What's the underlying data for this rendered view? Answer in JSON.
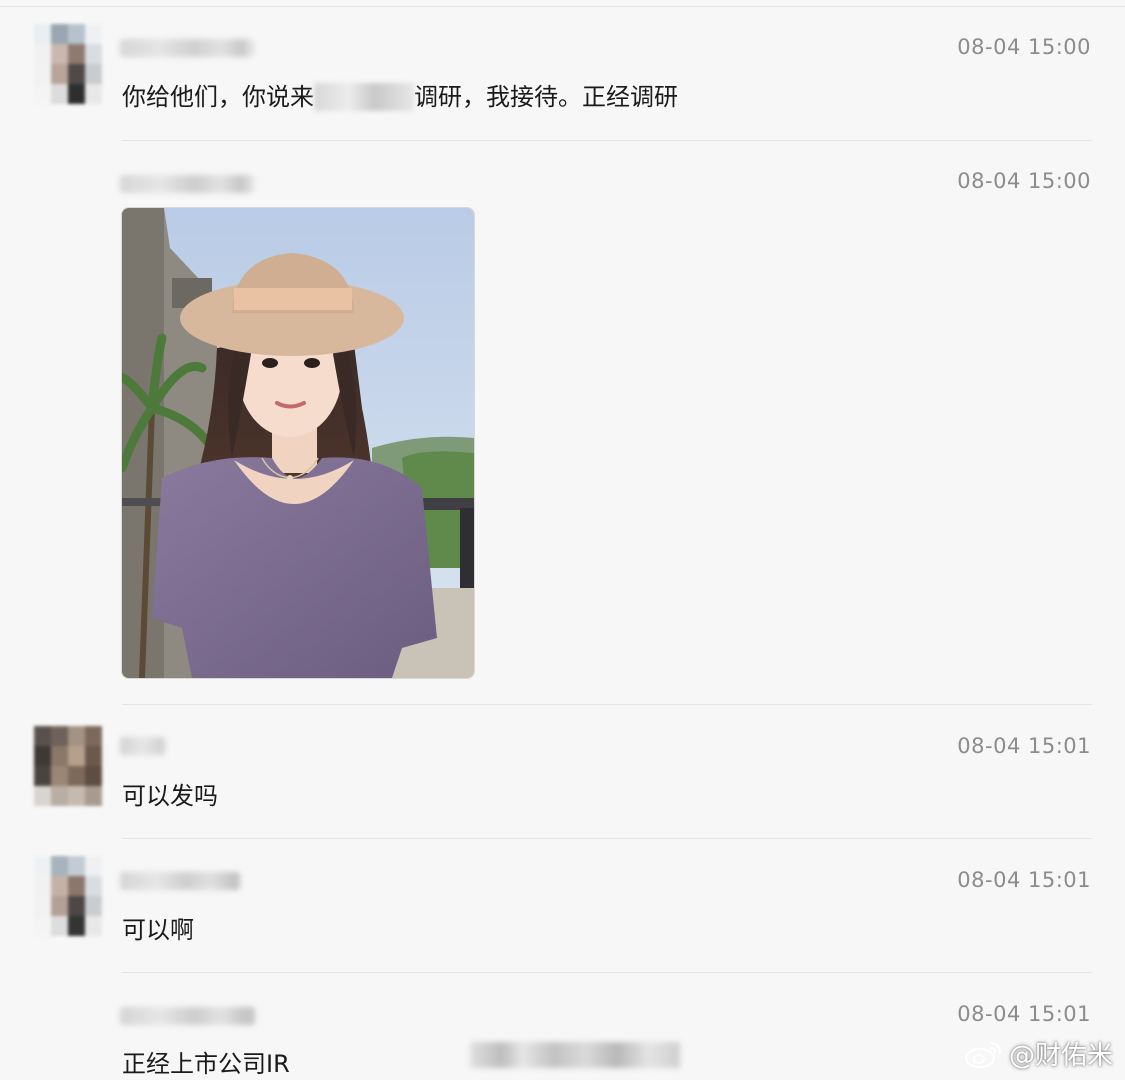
{
  "messages": [
    {
      "timestamp": "08-04 15:00",
      "text_before": "你给他们，你说来",
      "text_after": "调研，我接待。正经调研"
    },
    {
      "timestamp": "08-04 15:00",
      "image_alt": "照片"
    },
    {
      "timestamp": "08-04 15:01",
      "text": "可以发吗"
    },
    {
      "timestamp": "08-04 15:01",
      "text": "可以啊"
    },
    {
      "timestamp": "08-04 15:01",
      "text": "正经上市公司IR"
    }
  ],
  "watermark": {
    "text": "@财佑米",
    "icon": "weibo-logo-icon"
  },
  "colors": {
    "background": "#f7f7f7",
    "timestamp": "#8c8c8c",
    "text": "#1a1a1a",
    "divider": "#e4e4e4"
  }
}
